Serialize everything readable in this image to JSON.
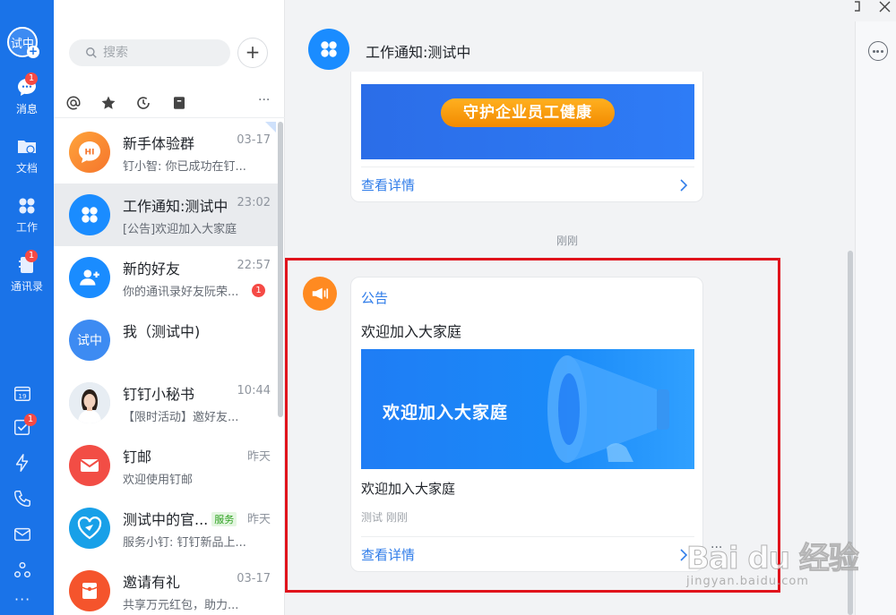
{
  "rail": {
    "avatar_text": "试中",
    "items": [
      {
        "label": "消息",
        "badge": "1"
      },
      {
        "label": "文档",
        "badge": ""
      },
      {
        "label": "工作",
        "badge": ""
      },
      {
        "label": "通讯录",
        "badge": "1"
      }
    ],
    "calendar_day": "19",
    "todo_badge": "1",
    "more": "···",
    "color": "#1a73e8"
  },
  "search": {
    "placeholder": "搜索"
  },
  "filter_more": "···",
  "sessions": [
    {
      "name": "新手体验群",
      "time": "03-17",
      "preview": "钉小智: 你已成功在钉...",
      "avatar_text": "HI",
      "color": "#ff8a21"
    },
    {
      "name": "工作通知:测试中",
      "time": "23:02",
      "preview": "[公告]欢迎加入大家庭",
      "color": "#1a8cff"
    },
    {
      "name": "新的好友",
      "time": "22:57",
      "preview": "你的通讯录好友阮荣...",
      "unread": "1",
      "color": "#1a8cff"
    },
    {
      "name": "我（测试中)",
      "time": "",
      "preview": "",
      "avatar_text": "试中",
      "color": "#3d8bf2"
    },
    {
      "name": "钉钉小秘书",
      "time": "10:44",
      "preview": "【限时活动】邀好友..."
    },
    {
      "name": "钉邮",
      "time": "昨天",
      "preview": "欢迎使用钉邮",
      "color": "#f24d45"
    },
    {
      "name": "测试中的官...",
      "tag": "服务",
      "time": "昨天",
      "preview": "服务小钉: 钉钉新品上...",
      "color": "#18a0e8"
    },
    {
      "name": "邀请有礼",
      "time": "03-17",
      "preview": "共享万元红包，助力...",
      "color": "#f5542c"
    }
  ],
  "chat": {
    "title": "工作通知:测试中",
    "card1": {
      "pill": "守护企业员工健康",
      "link": "查看详情"
    },
    "timestamp": "刚刚",
    "card2": {
      "type": "公告",
      "title": "欢迎加入大家庭",
      "banner_text": "欢迎加入大家庭",
      "subtitle": "欢迎加入大家庭",
      "meta": "测试 刚刚",
      "link": "查看详情",
      "more": "···"
    }
  },
  "watermark": {
    "main": "Bai du 经验",
    "sub": "jingyan.baidu.com"
  }
}
